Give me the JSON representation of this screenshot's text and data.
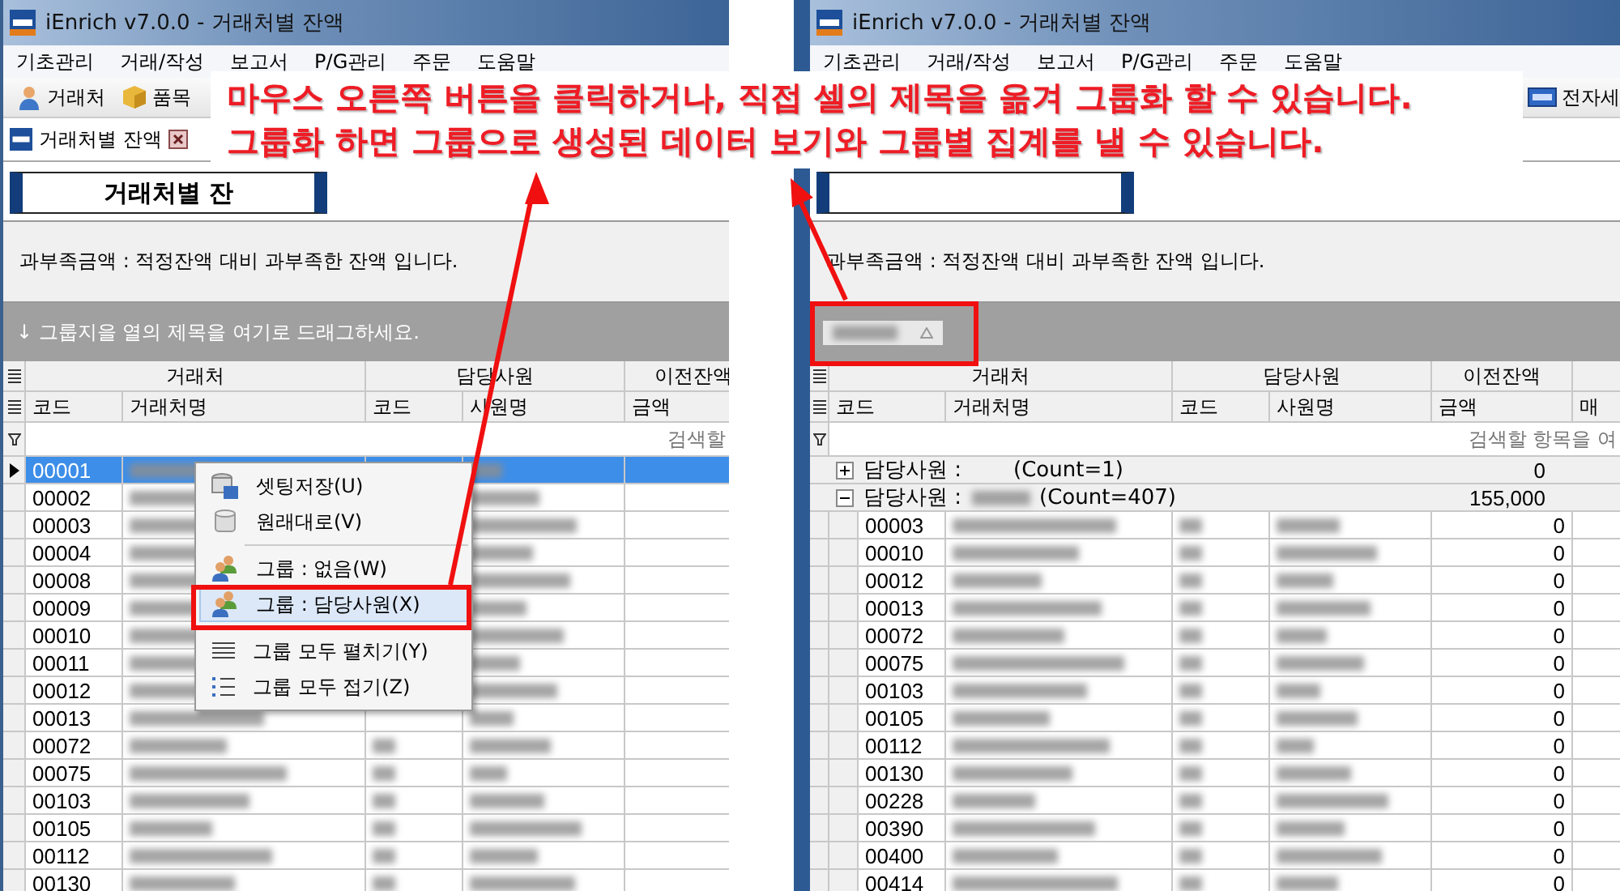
{
  "windows": [
    {
      "title": "iEnrich v7.0.0 - 거래처별 잔액",
      "menu": [
        "기초관리",
        "거래/작성",
        "보고서",
        "P/G관리",
        "주문",
        "도움말"
      ],
      "toolbar": [
        {
          "label": "거래처"
        },
        {
          "label": "품목"
        }
      ],
      "tab": {
        "label": "거래처별 잔액"
      },
      "report_title": "거래처별 잔",
      "description": "과부족금액 : 적정잔액 대비 과부족한 잔액 입니다.",
      "group_panel": {
        "kind": "hint",
        "hint": "↓ 그룹지을 열의 제목을 여기로 드래그하세요."
      },
      "band_headers": [
        "거래처",
        "담당사원",
        "이전잔액"
      ],
      "column_headers": [
        "코드",
        "거래처명",
        "코드",
        "사원명",
        "금액"
      ],
      "filter_hint": "검색할",
      "rows": [
        {
          "code": "00001",
          "selected": true
        },
        {
          "code": "00002",
          "selected": false
        },
        {
          "code": "00003",
          "selected": false
        },
        {
          "code": "00004",
          "selected": false
        },
        {
          "code": "00008",
          "selected": false
        },
        {
          "code": "00009",
          "selected": false
        },
        {
          "code": "00010",
          "selected": false
        },
        {
          "code": "00011",
          "selected": false
        },
        {
          "code": "00012",
          "selected": false
        },
        {
          "code": "00013",
          "selected": false
        },
        {
          "code": "00072",
          "selected": false
        },
        {
          "code": "00075",
          "selected": false
        },
        {
          "code": "00103",
          "selected": false
        },
        {
          "code": "00105",
          "selected": false
        },
        {
          "code": "00112",
          "selected": false
        },
        {
          "code": "00130",
          "selected": false
        }
      ]
    },
    {
      "title": "iEnrich v7.0.0 - 거래처별 잔액",
      "menu": [
        "기초관리",
        "거래/작성",
        "보고서",
        "P/G관리",
        "주문",
        "도움말"
      ],
      "toolbar": [
        {
          "label": "전자세"
        }
      ],
      "description": "과부족금액 : 적정잔액 대비 과부족한 잔액 입니다.",
      "group_panel": {
        "kind": "chips"
      },
      "band_headers": [
        "거래처",
        "담당사원",
        "이전잔액"
      ],
      "column_headers": [
        "코드",
        "거래처명",
        "코드",
        "사원명",
        "금액",
        "매"
      ],
      "filter_hint": "검색할 항목을 여",
      "groups": [
        {
          "label": "담당사원 :",
          "count": "(Count=1)",
          "total": "0",
          "expanded": false,
          "redacted_name": false
        },
        {
          "label": "담당사원 :",
          "count": "(Count=407)",
          "total": "155,000",
          "expanded": true,
          "redacted_name": true,
          "children": [
            {
              "code": "00003",
              "amount": "0",
              "selected": false
            },
            {
              "code": "00010",
              "amount": "0",
              "selected": false
            },
            {
              "code": "00012",
              "amount": "0",
              "selected": false
            },
            {
              "code": "00013",
              "amount": "0",
              "selected": false
            },
            {
              "code": "00072",
              "amount": "0",
              "selected": false
            },
            {
              "code": "00075",
              "amount": "0",
              "selected": false
            },
            {
              "code": "00103",
              "amount": "0",
              "selected": false
            },
            {
              "code": "00105",
              "amount": "0",
              "selected": false
            },
            {
              "code": "00112",
              "amount": "0",
              "selected": false
            },
            {
              "code": "00130",
              "amount": "0",
              "selected": false
            },
            {
              "code": "00228",
              "amount": "0",
              "selected": false
            },
            {
              "code": "00390",
              "amount": "0",
              "selected": false
            },
            {
              "code": "00400",
              "amount": "0",
              "selected": false
            },
            {
              "code": "00414",
              "amount": "0",
              "selected": false
            }
          ]
        }
      ]
    }
  ],
  "context_menu": {
    "items": [
      {
        "kind": "item",
        "label": "셋팅저장(U)",
        "selected": false
      },
      {
        "kind": "item",
        "label": "원래대로(V)",
        "selected": false
      },
      {
        "kind": "separator"
      },
      {
        "kind": "item",
        "label": "그룹 : 없음(W)",
        "selected": false
      },
      {
        "kind": "item",
        "label": "그룹 : 담당사원(X)",
        "selected": true
      },
      {
        "kind": "separator"
      },
      {
        "kind": "item",
        "label": "그룹 모두 펼치기(Y)",
        "selected": false
      },
      {
        "kind": "item",
        "label": "그룹 모두 접기(Z)",
        "selected": false
      }
    ]
  },
  "callout": {
    "lines": [
      "마우스 오른쪽 버튼을 클릭하거나, 직접 셀의 제목을 옮겨 그룹화 할 수 있습니다.",
      "그룹화 하면 그룹으로 생성된 데이터 보기와 그룹별 집계를 낼 수 있습니다."
    ]
  }
}
